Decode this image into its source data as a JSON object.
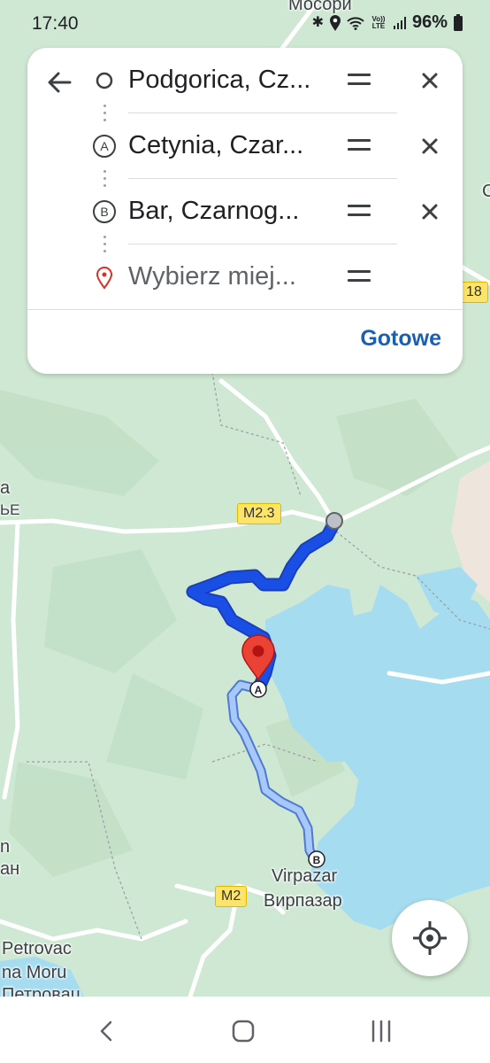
{
  "status_bar": {
    "time": "17:40",
    "battery": "96%",
    "lte_label": "Vo)) LTE",
    "icons": [
      "bluetooth-icon",
      "location-icon",
      "wifi-icon",
      "signal-icon",
      "battery-icon"
    ]
  },
  "directions": {
    "back_icon": "arrow-left-icon",
    "stops": [
      {
        "label": "Podgorica, Cz...",
        "marker": "origin-circle-icon",
        "placeholder": false
      },
      {
        "label": "Cetynia, Czar...",
        "marker": "A",
        "placeholder": false
      },
      {
        "label": "Bar, Czarnog...",
        "marker": "B",
        "placeholder": false
      },
      {
        "label": "Wybierz miej...",
        "marker": "destination-pin-icon",
        "placeholder": true
      }
    ],
    "done_label": "Gotowe"
  },
  "map": {
    "labels": {
      "top_cyrillic": "Мосори",
      "right_edge_c": "С",
      "left_a": "a",
      "left_bje": "ЬЕ",
      "left_n": "n",
      "left_an": "ан",
      "virpazar": "Virpazar",
      "virpazar_cyr": "Вирпазар",
      "petrovac": "Petrovac",
      "na_moru": "na Moru",
      "petrovac_cyr": "Петровац"
    },
    "road_shields": {
      "m23": "M2.3",
      "m2": "M2",
      "r18": "18"
    },
    "waypoint_markers": {
      "a": "A",
      "b": "B"
    },
    "colors": {
      "land": "#cfe8d3",
      "water": "#a6dcef",
      "route_primary": "#1a4fe6",
      "route_alt": "#a8c7fa",
      "pin": "#ea4335"
    }
  },
  "controls": {
    "locate_icon": "my-location-icon"
  },
  "nav_bar": {
    "back_icon": "nav-back-icon",
    "home_icon": "nav-home-icon",
    "recents_icon": "nav-recents-icon"
  }
}
